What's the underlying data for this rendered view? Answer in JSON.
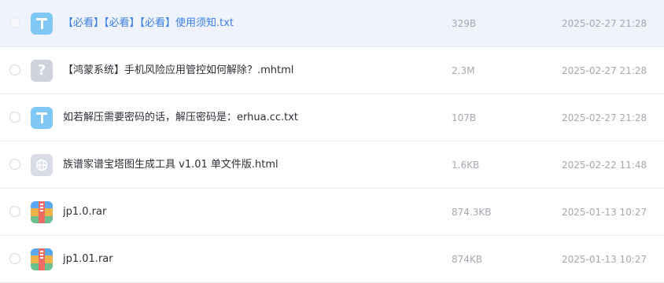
{
  "files": [
    {
      "name": "【必看】【必看】【必看】使用须知.txt",
      "size": "329B",
      "date": "2025-02-27 21:28",
      "icon": "txt-file-icon"
    },
    {
      "name": "【鸿蒙系统】手机风险应用管控如何解除？.mhtml",
      "size": "2.3M",
      "date": "2025-02-27 21:28",
      "icon": "unknown-file-icon"
    },
    {
      "name": "如若解压需要密码的话，解压密码是：erhua.cc.txt",
      "size": "107B",
      "date": "2025-02-27 21:28",
      "icon": "txt-file-icon"
    },
    {
      "name": "族谱家谱宝塔图生成工具 v1.01 单文件版.html",
      "size": "1.6KB",
      "date": "2025-02-22 11:48",
      "icon": "web-file-icon"
    },
    {
      "name": "jp1.0.rar",
      "size": "874.3KB",
      "date": "2025-01-13 10:27",
      "icon": "archive-file-icon"
    },
    {
      "name": "jp1.01.rar",
      "size": "874KB",
      "date": "2025-01-13 10:27",
      "icon": "archive-file-icon"
    }
  ],
  "icon_glyphs": {
    "unknown": "?"
  },
  "colors": {
    "hover_row_bg": "#eef3fd",
    "hover_text": "#3a7ee8",
    "txt_icon": "#7fc8f6"
  }
}
